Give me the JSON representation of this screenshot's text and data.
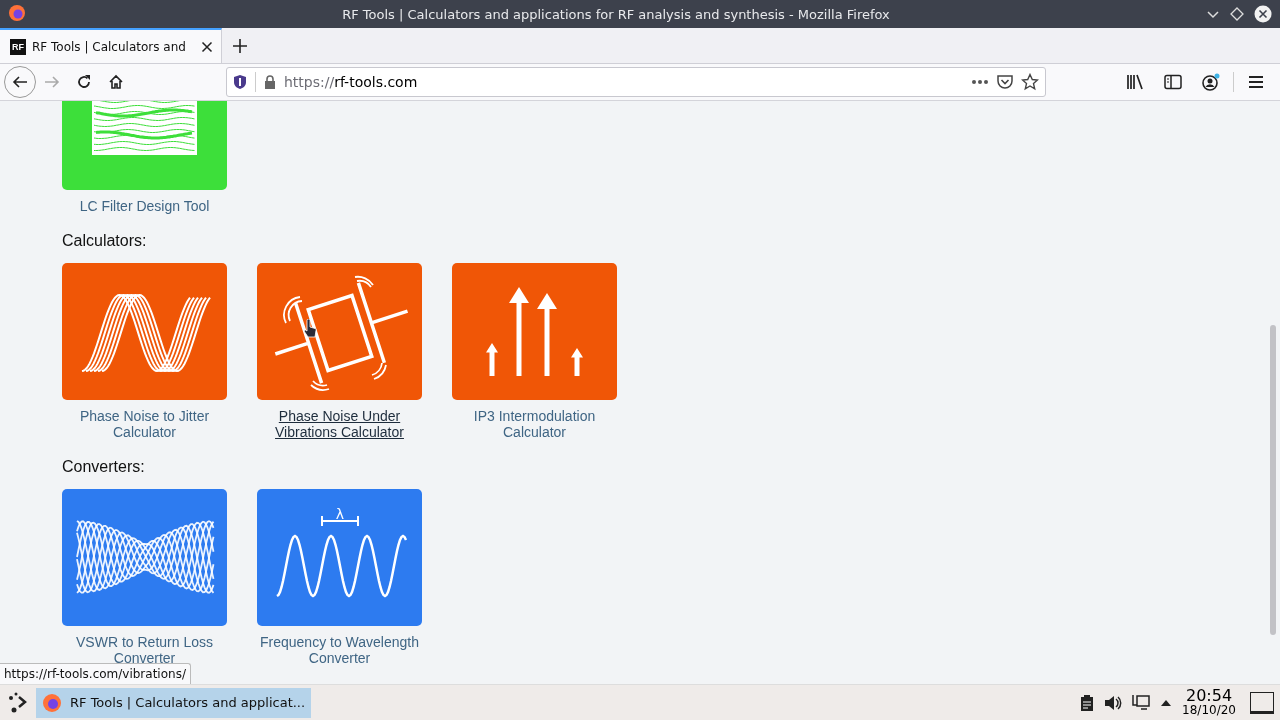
{
  "window": {
    "title": "RF Tools | Calculators and applications for RF analysis and synthesis - Mozilla Firefox"
  },
  "tabs": [
    {
      "favicon": "RF",
      "label": "RF Tools | Calculators and",
      "selected": true
    }
  ],
  "address_bar": {
    "url_scheme": "https://",
    "url_host": "rf-tools.com"
  },
  "sections": [
    {
      "tools": [
        {
          "label": "LC Filter Design Tool",
          "kind": "filter",
          "color": "#3ddf3a",
          "hovered": false
        }
      ]
    },
    {
      "heading": "Calculators:",
      "tools": [
        {
          "label": "Phase Noise to Jitter Calculator",
          "kind": "jitter",
          "color": "#f05606",
          "hovered": false
        },
        {
          "label": "Phase Noise Under Vibrations Calculator",
          "kind": "vibration",
          "color": "#f05606",
          "hovered": true
        },
        {
          "label": "IP3 Intermodulation Calculator",
          "kind": "ip3",
          "color": "#f05606",
          "hovered": false
        }
      ]
    },
    {
      "heading": "Converters:",
      "tools": [
        {
          "label": "VSWR to Return Loss Converter",
          "kind": "vswr",
          "color": "#2d7bf0",
          "hovered": false
        },
        {
          "label": "Frequency to Wavelength Converter",
          "kind": "wavelength",
          "color": "#2d7bf0",
          "hovered": false,
          "symbol": "λ"
        }
      ]
    }
  ],
  "status_link": "https://rf-tools.com/vibrations/",
  "taskbar": {
    "tasks": [
      {
        "label": "RF Tools | Calculators and applicat...",
        "selected": true
      }
    ],
    "time": "20:54",
    "date": "18/10/20"
  }
}
